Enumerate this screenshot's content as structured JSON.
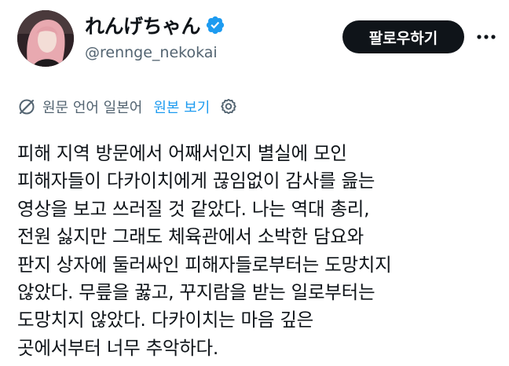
{
  "author": {
    "display_name": "れんげちゃん",
    "handle": "@rennge_nekokai",
    "verified": true,
    "avatar_icon": "profile-photo"
  },
  "actions": {
    "follow_label": "팔로우하기",
    "more_icon": "more-horizontal-icon"
  },
  "translation": {
    "source_language": "원문 언어 일본어",
    "show_original_label": "원본 보기",
    "translate_icon": "translate-icon",
    "settings_icon": "gear-icon"
  },
  "tweet": {
    "lines": [
      "피해 지역 방문에서 어째서인지 별실에 모인",
      "피해자들이 다카이치에게 끊임없이 감사를 읊는",
      "영상을 보고 쓰러질 것 같았다. 나는 역대 총리,",
      "전원 싫지만 그래도 체육관에서 소박한 담요와",
      "판지 상자에 둘러싸인 피해자들로부터는 도망치지",
      "않았다. 무릎을 꿇고, 꾸지람을 받는 일로부터는",
      "도망치지 않았다. 다카이치는 마음 깊은",
      "곳에서부터 너무 추악하다."
    ]
  },
  "colors": {
    "text": "#0f1419",
    "secondary": "#536471",
    "link": "#1d9bf0",
    "button_bg": "#0f1419",
    "verified": "#1d9bf0"
  }
}
